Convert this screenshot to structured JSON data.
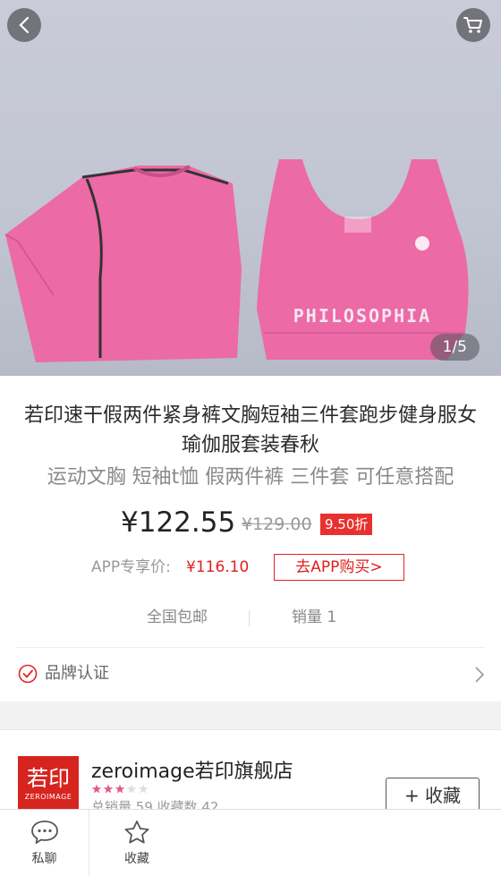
{
  "hero": {
    "image_counter": "1/5",
    "print_text": "PHILOSOPHIA"
  },
  "product": {
    "title": "若印速干假两件紧身裤文胸短袖三件套跑步健身服女瑜伽服套装春秋",
    "subtitle": "运动文胸 短袖t恤 假两件裤 三件套 可任意搭配",
    "price": "¥122.55",
    "original_price": "¥129.00",
    "discount": "9.50折",
    "app_price_label": "APP专享价:",
    "app_price": "¥116.10",
    "app_button": "去APP购买>",
    "shipping": "全国包邮",
    "sales": "销量 1",
    "brand_cert": "品牌认证"
  },
  "shop": {
    "logo_text": "若印",
    "logo_sub": "ZEROIMAGE",
    "name": "zeroimage若印旗舰店",
    "rating_stars": 3,
    "rating_max": 5,
    "meta": "总销量 59    收藏数 42",
    "follow_button": "+ 收藏"
  },
  "bottom_bar": {
    "chat_label": "私聊",
    "favorite_label": "收藏"
  },
  "colors": {
    "accent_red": "#e01e1e",
    "pink_garment": "#ec6aa6",
    "star_active": "#e35a88",
    "star_inactive": "#dddddd"
  }
}
